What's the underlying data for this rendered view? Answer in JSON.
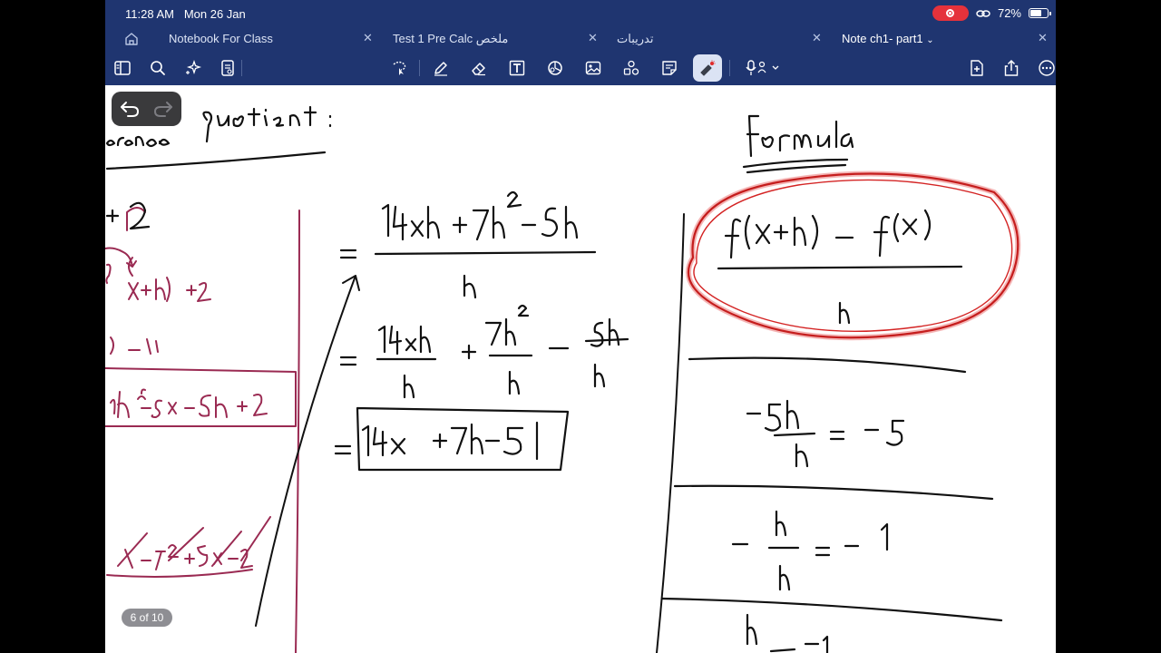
{
  "status_bar": {
    "time": "11:28 AM",
    "date": "Mon 26 Jan",
    "battery": "72%",
    "battery_level": 0.72
  },
  "tabs": [
    {
      "label": "Notebook For Class",
      "active": false
    },
    {
      "label": "Test 1 Pre Calc ملخص",
      "active": false
    },
    {
      "label": "تدريبات",
      "active": false
    },
    {
      "label": "Note ch1- part1",
      "active": true
    }
  ],
  "toolbar": {
    "left_tools": [
      "sidebar-icon",
      "search-icon",
      "sparkle-icon",
      "document-icon"
    ],
    "draw_tools": [
      "lasso-icon",
      "pen-icon",
      "eraser-icon",
      "text-box-icon",
      "shapes-icon",
      "image-icon",
      "elements-icon",
      "sticky-note-icon",
      "laser-pointer-icon",
      "microphone-icon"
    ],
    "right_tools": [
      "add-page-icon",
      "share-icon",
      "more-icon"
    ],
    "selected_tool": "laser-pointer-icon"
  },
  "page_indicator": "6 of 10",
  "colors": {
    "bar": "#1f3570",
    "ink": "#111111",
    "maroon_ink": "#9a2a52",
    "highlight": "#e02a2a"
  }
}
